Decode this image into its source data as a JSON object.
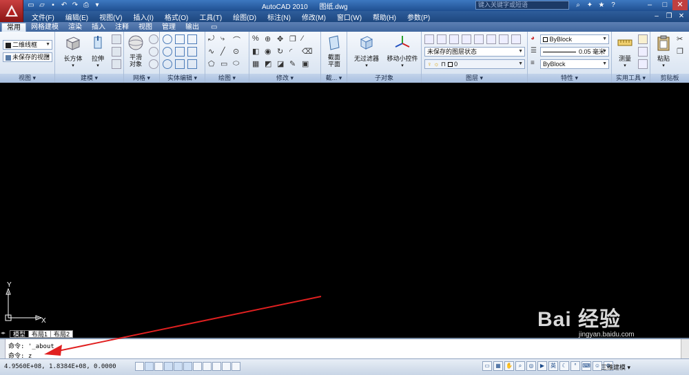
{
  "title_bar": {
    "app_name": "AutoCAD 2010",
    "file_name": "图纸.dwg",
    "search_placeholder": "键入关键字或短语"
  },
  "menu": {
    "items": [
      "文件(F)",
      "编辑(E)",
      "视图(V)",
      "插入(I)",
      "格式(O)",
      "工具(T)",
      "绘图(D)",
      "标注(N)",
      "修改(M)",
      "窗口(W)",
      "帮助(H)",
      "参数(P)"
    ]
  },
  "ribbon_tabs": [
    "常用",
    "网格建模",
    "渲染",
    "插入",
    "注释",
    "视图",
    "管理",
    "输出"
  ],
  "ribbon": {
    "view_panel": {
      "title": "视图",
      "visual_style": "二维线框",
      "view": "未保存的视图"
    },
    "modeling_panel": {
      "title": "建模",
      "box": "长方体",
      "extrude": "拉伸"
    },
    "mesh_panel": {
      "title": "网格",
      "smooth": "平滑\n对象"
    },
    "solid_edit_panel": {
      "title": "实体编辑"
    },
    "draw_panel": {
      "title": "绘图"
    },
    "modify_panel": {
      "title": "修改"
    },
    "section_panel": {
      "title": "截...",
      "section_plane": "截面\n平面"
    },
    "subobject_panel": {
      "title": "子对象",
      "no_filter": "无过滤器",
      "move_gizmo": "移动小控件"
    },
    "layers_panel": {
      "title": "图层",
      "layer_state": "未保存的图层状态",
      "layer_value": "0"
    },
    "properties_panel": {
      "title": "特性",
      "color": "ByBlock",
      "lineweight": "0.05 毫米",
      "linetype": "ByBlock"
    },
    "utilities_panel": {
      "title": "实用工具",
      "measure": "测量"
    },
    "clipboard_panel": {
      "title": "剪贴板",
      "paste": "粘贴"
    }
  },
  "canvas": {
    "ucs_x": "X",
    "ucs_y": "Y"
  },
  "layout_tabs": [
    "模型",
    "布局1",
    "布局2"
  ],
  "command_line": {
    "line1": "命令: '_about",
    "line2": "命令: z"
  },
  "status_bar": {
    "coordinates": "4.9560E+08, 1.8384E+08, 0.0000",
    "language": "英",
    "workspace": "三维建模"
  },
  "watermark": {
    "brand": "Bai 经验",
    "url": "jingyan.baidu.com"
  },
  "colors": {
    "accent": "#2e5d9b",
    "canvas": "#000000",
    "annotation_arrow": "#e02020"
  }
}
